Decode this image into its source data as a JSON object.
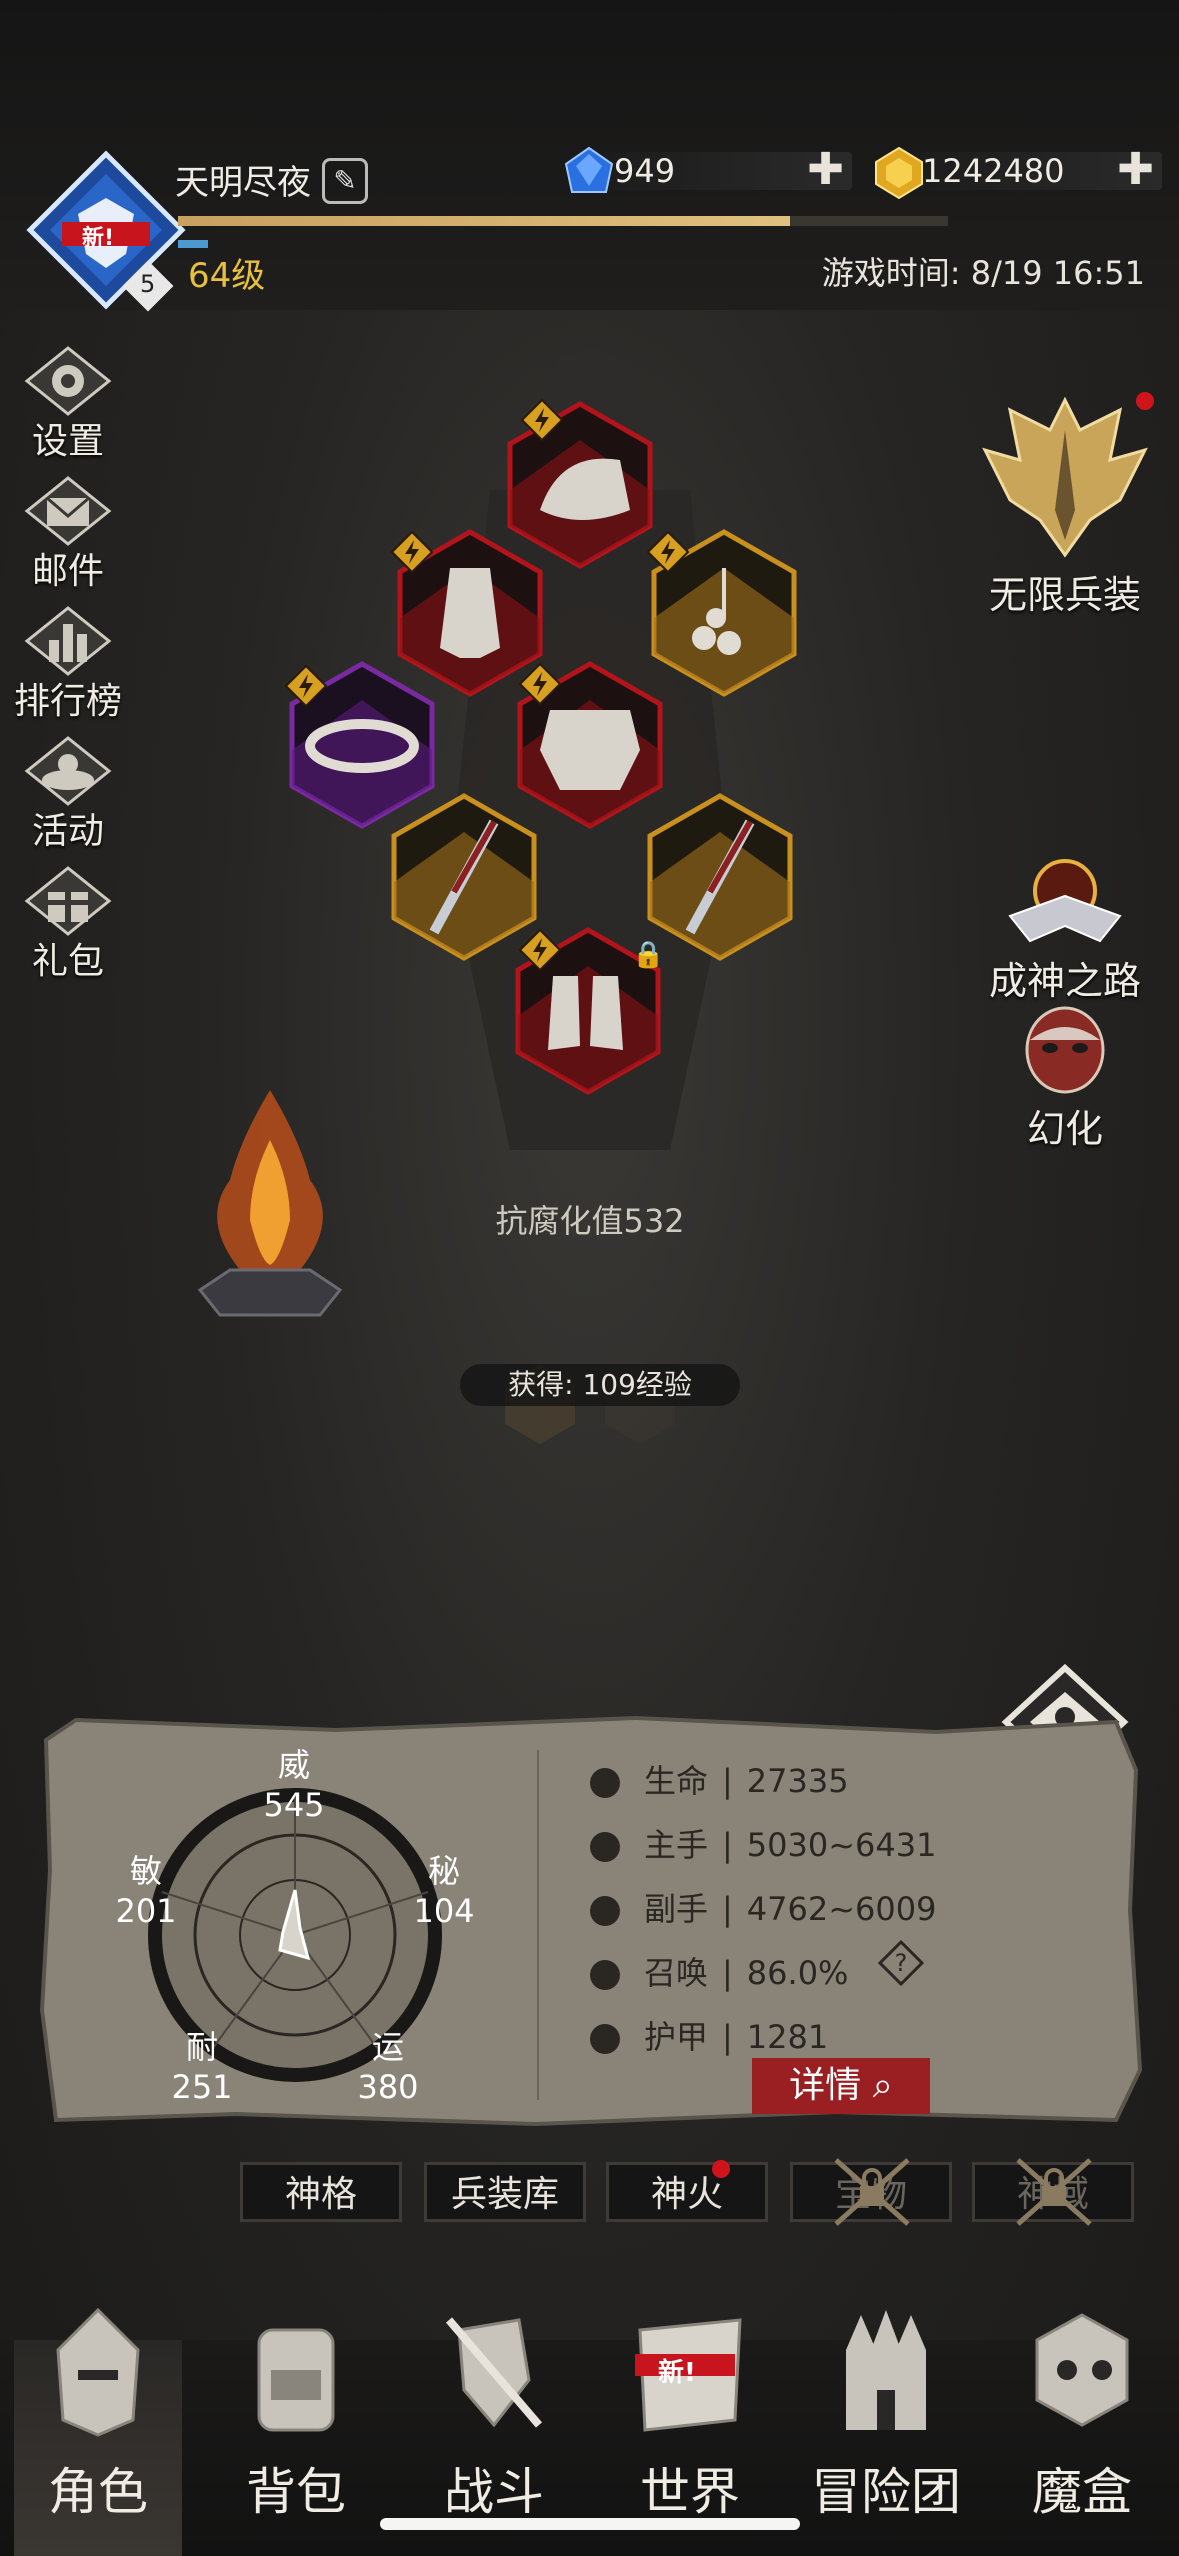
{
  "player": {
    "name": "天明尽夜",
    "level": "64级",
    "avatar_badge": "新!",
    "avatar_rank": "5",
    "xp_fraction": 0.78
  },
  "currencies": {
    "diamonds": "949",
    "gold": "1242480"
  },
  "game_time": "游戏时间: 8/19 16:51",
  "left_menu": [
    "设置",
    "邮件",
    "排行榜",
    "活动",
    "礼包"
  ],
  "right_menu": {
    "infinite_gear": "无限兵装",
    "path_to_god": "成神之路",
    "transform": "幻化"
  },
  "equipment": {
    "slots": [
      "hat",
      "gloves",
      "earring",
      "belt",
      "armor",
      "weapon-left",
      "weapon-right",
      "boots"
    ],
    "colors": {
      "red": "#b3141b",
      "gold": "#c9901e",
      "purple": "#7a2aa0"
    }
  },
  "resist_text": "抗腐化值532",
  "gain_text": "获得: 109经验",
  "attributes": {
    "wei": {
      "label": "威",
      "value": "545"
    },
    "mi": {
      "label": "秘",
      "value": "104"
    },
    "yun": {
      "label": "运",
      "value": "380"
    },
    "nai": {
      "label": "耐",
      "value": "251"
    },
    "min": {
      "label": "敏",
      "value": "201"
    }
  },
  "stats": [
    {
      "label": "生命",
      "value": "27335"
    },
    {
      "label": "主手",
      "value": "5030~6431"
    },
    {
      "label": "副手",
      "value": "4762~6009"
    },
    {
      "label": "召唤",
      "value": "86.0%"
    },
    {
      "label": "护甲",
      "value": "1281"
    }
  ],
  "separator": "|",
  "detail_button": "详情",
  "tabs": [
    "神格",
    "兵装库",
    "神火",
    "宝物",
    "神域"
  ],
  "bottom_nav": [
    "角色",
    "背包",
    "战斗",
    "世界",
    "冒险团",
    "魔盒"
  ],
  "world_badge": "新!"
}
